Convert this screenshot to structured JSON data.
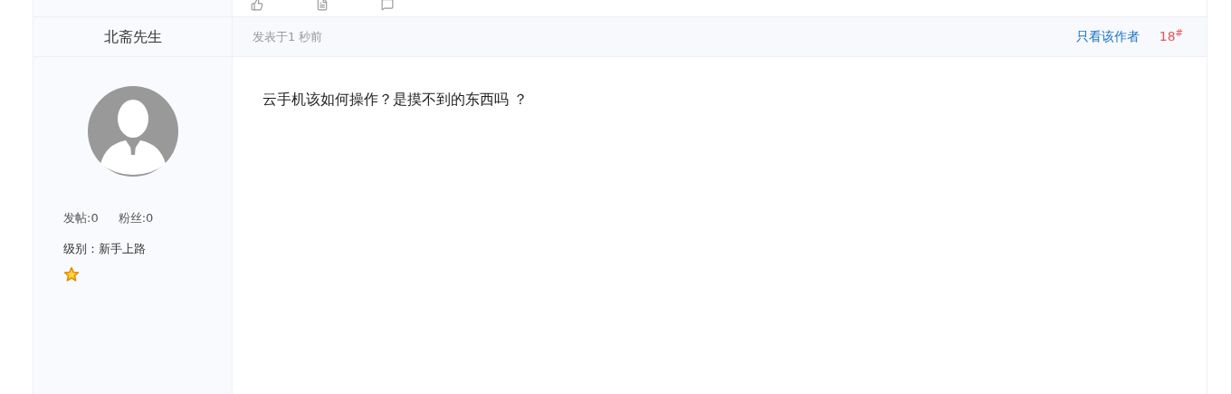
{
  "author": {
    "name": "北斋先生",
    "stats": [
      {
        "label": "发帖:0"
      },
      {
        "label": "粉丝:0"
      }
    ],
    "level": "级别：新手上路"
  },
  "post": {
    "time": "发表于1 秒前",
    "only_author_link": "只看该作者",
    "floor": "18",
    "floor_mark": "#",
    "body": "云手机该如何操作？是摸不到的东西吗 ？"
  }
}
